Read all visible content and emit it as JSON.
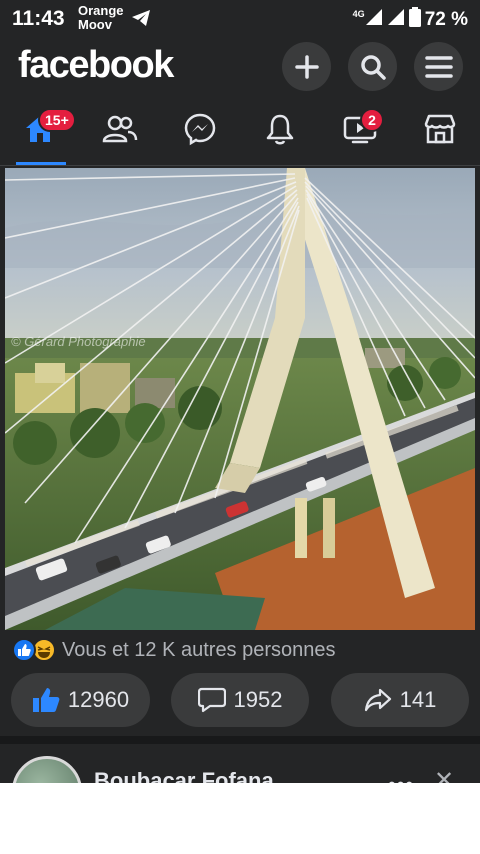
{
  "status_bar": {
    "time": "11:43",
    "carrier_line1": "Orange",
    "carrier_line2": "Moov",
    "network": "4G",
    "battery": "72 %"
  },
  "header": {
    "logo": "facebook",
    "icons": [
      "plus-icon",
      "search-icon",
      "menu-icon"
    ]
  },
  "nav": {
    "tabs": [
      {
        "name": "home",
        "icon": "home-icon",
        "badge": "15+",
        "active": true
      },
      {
        "name": "friends",
        "icon": "friends-icon",
        "badge": ""
      },
      {
        "name": "messenger",
        "icon": "messenger-icon",
        "badge": ""
      },
      {
        "name": "notifications",
        "icon": "bell-icon",
        "badge": ""
      },
      {
        "name": "watch",
        "icon": "watch-icon",
        "badge": "2"
      },
      {
        "name": "marketplace",
        "icon": "marketplace-icon",
        "badge": ""
      }
    ]
  },
  "post": {
    "image_watermark": "© Gérard Photographie",
    "reactions_text": "Vous et 12 K autres personnes",
    "like_count": "12960",
    "comment_count": "1952",
    "share_count": "141"
  },
  "next_post": {
    "author": "Boubacar Fofana"
  },
  "colors": {
    "background": "#242526",
    "accent": "#1877f2",
    "badge": "#e41e3f",
    "button_bg": "#3a3b3c"
  }
}
